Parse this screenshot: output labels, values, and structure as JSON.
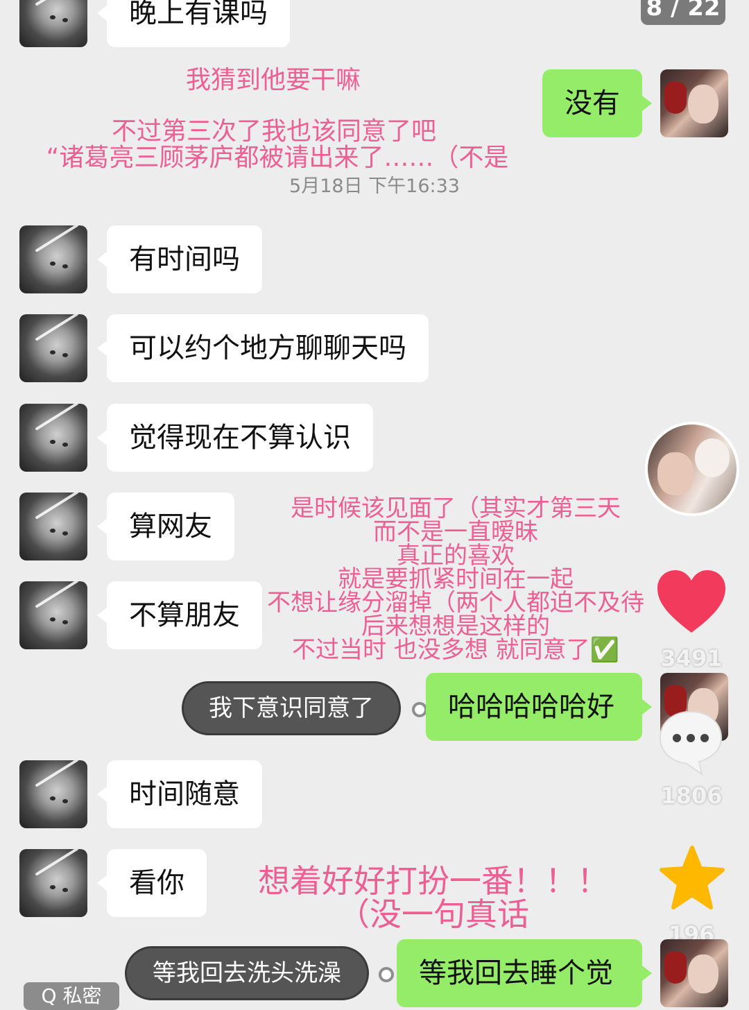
{
  "page_counter": "8 / 22",
  "timestamp": "5月18日 下午16:33",
  "messages": {
    "m1": "晚上有课吗",
    "m2": "没有",
    "m3": "有时间吗",
    "m4": "可以约个地方聊聊天吗",
    "m5": "觉得现在不算认识",
    "m6": "算网友",
    "m7": "不算朋友",
    "m8": "哈哈哈哈哈好",
    "m9": "时间随意",
    "m10": "看你",
    "m11": "等我回去睡个觉"
  },
  "overlays": {
    "o1": "我猜到他要干嘛",
    "o2": "不过第三次了我也该同意了吧",
    "o3": "“诸葛亮三顾茅庐都被请出来了……（不是",
    "o4": [
      "是时候该见面了（其实才第三天",
      "而不是一直暧昧",
      "真正的喜欢",
      "就是要抓紧时间在一起",
      "不想让缘分溜掉（两个人都迫不及待",
      "后来想想是这样的",
      "不过当时 也没多想 就同意了✅"
    ],
    "o5": [
      "想着好好打扮一番！！！",
      "（没一句真话"
    ]
  },
  "pills": {
    "p1": "我下意识同意了",
    "p2": "等我回去洗头洗澡"
  },
  "sidebar": {
    "like_count": "3491",
    "comment_count": "1806",
    "favorite_count": "196"
  },
  "bottom_label": "Q 私密",
  "colors": {
    "overlay_text": "#ec5f93",
    "green_bubble": "#95ec69",
    "heart": "#f23a5d",
    "star": "#ffb800"
  }
}
